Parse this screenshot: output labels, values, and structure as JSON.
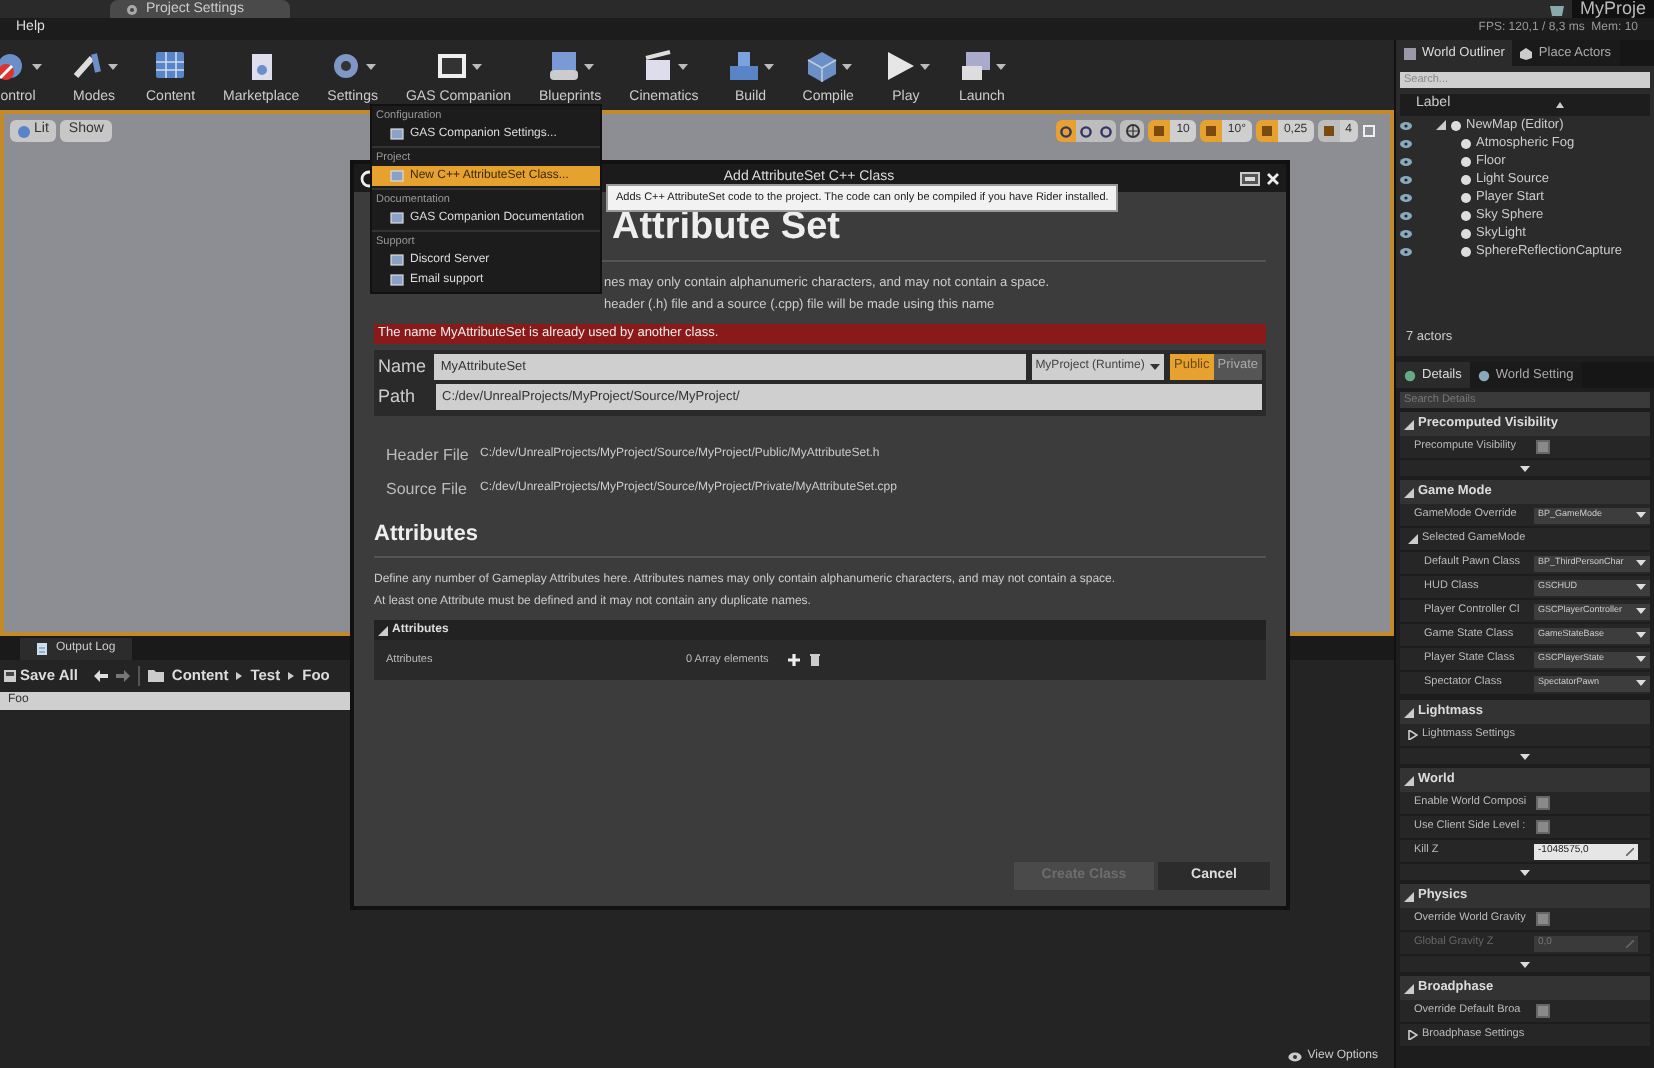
{
  "title_bar": {
    "tab": "Project Settings",
    "project": "MyProje"
  },
  "menu_bar": {
    "items": [
      "Help"
    ],
    "stats": "FPS: 120,1 / 8,3 ms  Mem: 10"
  },
  "toolbar": [
    {
      "label": "ontrol",
      "dropdown": true
    },
    {
      "label": "Modes",
      "dropdown": true
    },
    {
      "label": "Content",
      "dropdown": false
    },
    {
      "label": "Marketplace",
      "dropdown": false
    },
    {
      "label": "Settings",
      "dropdown": true
    },
    {
      "label": "GAS Companion",
      "dropdown": true
    },
    {
      "label": "Blueprints",
      "dropdown": true
    },
    {
      "label": "Cinematics",
      "dropdown": true
    },
    {
      "label": "Build",
      "dropdown": true
    },
    {
      "label": "Compile",
      "dropdown": true
    },
    {
      "label": "Play",
      "dropdown": true
    },
    {
      "label": "Launch",
      "dropdown": true
    }
  ],
  "viewport": {
    "left_buttons": [
      "Lit",
      "Show"
    ],
    "snaps": [
      {
        "value": "10",
        "active": true
      },
      {
        "value": "10°",
        "active": true
      },
      {
        "value": "0,25",
        "active": true
      },
      {
        "value": "4",
        "active": false
      }
    ]
  },
  "menu": {
    "sections": [
      {
        "header": "Configuration",
        "items": [
          {
            "label": "GAS Companion Settings...",
            "selected": false
          }
        ]
      },
      {
        "header": "Project",
        "items": [
          {
            "label": "New C++ AttributeSet Class...",
            "selected": true
          }
        ]
      },
      {
        "header": "Documentation",
        "items": [
          {
            "label": "GAS Companion Documentation",
            "selected": false
          }
        ]
      },
      {
        "header": "Support",
        "items": [
          {
            "label": "Discord Server",
            "selected": false
          },
          {
            "label": "Email support",
            "selected": false
          }
        ]
      }
    ]
  },
  "tooltip": "Adds C++ AttributeSet code to the project. The code can only be compiled if you have Rider installed.",
  "dialog": {
    "title": "Add AttributeSet C++ Class",
    "heading": "Attribute Set",
    "intro": [
      "nes may only contain alphanumeric characters, and may not contain a space.",
      "header (.h) file and a source (.cpp) file will be made using this name"
    ],
    "error": "The name MyAttributeSet is already used by another class.",
    "name_label": "Name",
    "name_value": "MyAttributeSet",
    "module": "MyProject (Runtime)",
    "visibility": [
      {
        "label": "Public",
        "selected": true
      },
      {
        "label": "Private",
        "selected": false
      }
    ],
    "path_label": "Path",
    "path_value": "C:/dev/UnrealProjects/MyProject/Source/MyProject/",
    "files": [
      {
        "label": "Header File",
        "path": "C:/dev/UnrealProjects/MyProject/Source/MyProject/Public/MyAttributeSet.h"
      },
      {
        "label": "Source File",
        "path": "C:/dev/UnrealProjects/MyProject/Source/MyProject/Private/MyAttributeSet.cpp"
      }
    ],
    "attributes_heading": "Attributes",
    "attributes_desc": [
      "Define any number of Gameplay Attributes here. Attributes names may only contain alphanumeric characters, and may not contain a space.",
      "At least one Attribute must be defined and it may not contain any duplicate names."
    ],
    "attributes_panel": {
      "header": "Attributes",
      "expanded": true,
      "row_label": "Attributes",
      "row_value": "0 Array elements"
    },
    "buttons": [
      {
        "label": "Create Class",
        "disabled": true
      },
      {
        "label": "Cancel",
        "disabled": false
      }
    ]
  },
  "outliner": {
    "tabs": [
      {
        "label": "World Outliner",
        "selected": true
      },
      {
        "label": "Place Actors",
        "selected": false
      }
    ],
    "search_placeholder": "Search...",
    "column": "Label",
    "tree": [
      {
        "label": "NewMap (Editor)",
        "expanded": true,
        "children": [
          {
            "label": "Atmospheric Fog"
          },
          {
            "label": "Floor"
          },
          {
            "label": "Light Source"
          },
          {
            "label": "Player Start"
          },
          {
            "label": "Sky Sphere"
          },
          {
            "label": "SkyLight"
          },
          {
            "label": "SphereReflectionCapture"
          }
        ]
      }
    ],
    "count": "7 actors"
  },
  "details": {
    "tabs": [
      {
        "label": "Details",
        "selected": true
      },
      {
        "label": "World Setting",
        "selected": false
      }
    ],
    "search_placeholder": "Search Details",
    "sections": [
      {
        "title": "Precomputed Visibility",
        "more": true,
        "rows": [
          {
            "kind": "checkbox",
            "label": "Precompute Visibility",
            "checked": false
          }
        ]
      },
      {
        "title": "Game Mode",
        "more": false,
        "rows": [
          {
            "kind": "dropdown",
            "label": "GameMode Override",
            "value": "BP_GameMode"
          },
          {
            "kind": "group",
            "label": "Selected GameMode",
            "expanded": true
          },
          {
            "kind": "dropdown",
            "label": "Default Pawn Class",
            "value": "BP_ThirdPersonChar"
          },
          {
            "kind": "dropdown",
            "label": "HUD Class",
            "value": "GSCHUD"
          },
          {
            "kind": "dropdown",
            "label": "Player Controller Cl",
            "value": "GSCPlayerController"
          },
          {
            "kind": "dropdown",
            "label": "Game State Class",
            "value": "GameStateBase"
          },
          {
            "kind": "dropdown",
            "label": "Player State Class",
            "value": "GSCPlayerState"
          },
          {
            "kind": "dropdown",
            "label": "Spectator Class",
            "value": "SpectatorPawn"
          }
        ]
      },
      {
        "title": "Lightmass",
        "more": true,
        "rows": [
          {
            "kind": "group",
            "label": "Lightmass Settings",
            "expanded": false
          }
        ]
      },
      {
        "title": "World",
        "more": true,
        "rows": [
          {
            "kind": "checkbox",
            "label": "Enable World Composi",
            "checked": false
          },
          {
            "kind": "checkbox",
            "label": "Use Client Side Level :",
            "checked": false
          },
          {
            "kind": "number",
            "label": "Kill Z",
            "value": "-1048575,0",
            "disabled": false
          }
        ]
      },
      {
        "title": "Physics",
        "more": true,
        "rows": [
          {
            "kind": "checkbox",
            "label": "Override World Gravity",
            "checked": false
          },
          {
            "kind": "number",
            "label": "Global Gravity Z",
            "value": "0,0",
            "disabled": true
          }
        ]
      },
      {
        "title": "Broadphase",
        "more": false,
        "rows": [
          {
            "kind": "checkbox",
            "label": "Override Default Broa",
            "checked": false
          },
          {
            "kind": "group",
            "label": "Broadphase Settings",
            "expanded": false
          }
        ]
      }
    ]
  },
  "content_browser": {
    "tab": "Output Log",
    "save": "Save All",
    "breadcrumbs": [
      "Content",
      "Test",
      "Foo"
    ],
    "search_value": "Foo",
    "view_options": "View Options"
  }
}
